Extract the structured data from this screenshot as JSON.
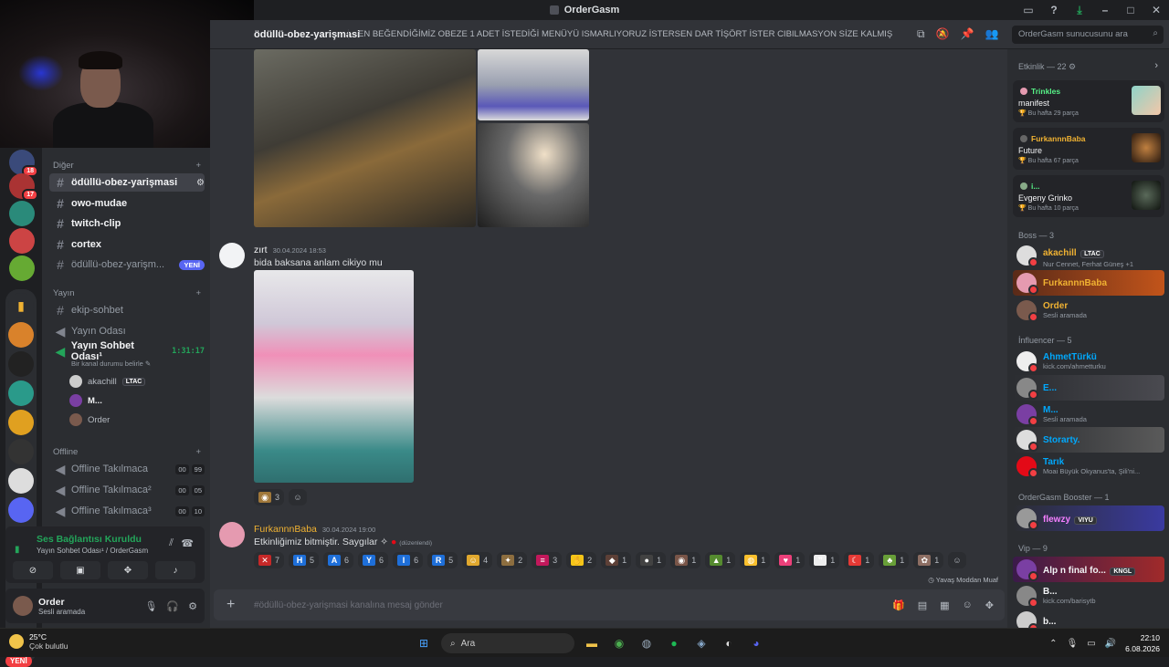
{
  "window": {
    "title": "OrderGasm"
  },
  "header": {
    "channel": "ödüllü-obez-yarişmasi",
    "topic": "EN BEĞENDİĞİMİZ OBEZE 1 ADET İSTEDİĞİ MENÜYÜ ISMARLIYORUZ İSTERSEN DAR TİŞÖRT İSTER CIBILMASYON SİZE KALMIŞ",
    "search_placeholder": "OrderGasm sunucusunu ara"
  },
  "servers": {
    "badges": [
      "18",
      "17"
    ],
    "new_label": "YENİ"
  },
  "channels": {
    "cat_other": "Diğer",
    "items_other": [
      {
        "name": "ödüllü-obez-yarişmasi"
      },
      {
        "name": "owo-mudae"
      },
      {
        "name": "twitch-clip"
      },
      {
        "name": "cortex"
      },
      {
        "name": "ödüllü-obez-yarişm...",
        "badge": "YENİ"
      }
    ],
    "cat_stream": "Yayın",
    "ekip": "ekip-sohbet",
    "yayin_odasi": "Yayın Odası",
    "yayin_sohbet": "Yayın Sohbet Odası¹",
    "timer": "1:31:17",
    "status_hint": "Bir kanal durumu belirle",
    "voice_users": [
      {
        "name": "akachill",
        "tag": "LTAC"
      },
      {
        "name": "M..."
      },
      {
        "name": "Order"
      }
    ],
    "cat_offline": "Offline",
    "offline": [
      {
        "name": "Offline Takılmaca",
        "c1": "00",
        "c2": "99"
      },
      {
        "name": "Offline Takılmaca²",
        "c1": "00",
        "c2": "05"
      },
      {
        "name": "Offline Takılmaca³",
        "c1": "00",
        "c2": "10"
      }
    ]
  },
  "voice": {
    "status": "Ses Bağlantısı Kuruldu",
    "sub": "Yayın Sohbet Odası¹ / OrderGasm"
  },
  "user": {
    "name": "Order",
    "status": "Sesli aramada"
  },
  "messages": [
    {
      "author": "zırt",
      "time": "30.04.2024 18:53",
      "text": "bida baksana anlam cikiyo mu",
      "reaction_count": "3"
    },
    {
      "author": "FurkannnBaba",
      "time": "30.04.2024 19:00",
      "text": "Etkinliğimiz bitmiştir. Saygılar",
      "edited": "(düzenlendi)"
    }
  ],
  "reactions": [
    {
      "glyph": "✕",
      "count": "7",
      "color": "#c62828"
    },
    {
      "glyph": "H",
      "count": "5",
      "color": "#1e6fd9"
    },
    {
      "glyph": "A",
      "count": "6",
      "color": "#1e6fd9"
    },
    {
      "glyph": "Y",
      "count": "6",
      "color": "#1e6fd9"
    },
    {
      "glyph": "I",
      "count": "6",
      "color": "#1e6fd9"
    },
    {
      "glyph": "R",
      "count": "5",
      "color": "#1e6fd9"
    },
    {
      "glyph": "☺",
      "count": "4",
      "color": "#e0a82e"
    },
    {
      "glyph": "✦",
      "count": "2",
      "color": "#8d6e3f"
    },
    {
      "glyph": "≡",
      "count": "3",
      "color": "#c2185b"
    },
    {
      "glyph": "✋",
      "count": "2",
      "color": "#f5c518"
    },
    {
      "glyph": "◆",
      "count": "1",
      "color": "#5d4037"
    },
    {
      "glyph": "●",
      "count": "1",
      "color": "#424242"
    },
    {
      "glyph": "◉",
      "count": "1",
      "color": "#795548"
    },
    {
      "glyph": "▲",
      "count": "1",
      "color": "#558b2f"
    },
    {
      "glyph": "◍",
      "count": "1",
      "color": "#fbc02d"
    },
    {
      "glyph": "♥",
      "count": "1",
      "color": "#ec407a"
    },
    {
      "glyph": "❞",
      "count": "1",
      "color": "#eeeeee"
    },
    {
      "glyph": "☾",
      "count": "1",
      "color": "#e53935"
    },
    {
      "glyph": "♣",
      "count": "1",
      "color": "#689f38"
    },
    {
      "glyph": "✿",
      "count": "1",
      "color": "#8d6e63"
    }
  ],
  "slowmode": "Yavaş Moddan Muaf",
  "composer_placeholder": "#ödüllü-obez-yarişmasi kanalına mesaj gönder",
  "members": {
    "activity_header": "Etkinlik — 22",
    "activities": [
      {
        "user": "Trinkles",
        "title": "manifest",
        "meta": "Bu hafta 29 parça",
        "color": "#57f287"
      },
      {
        "user": "FurkannnBaba",
        "title": "Future",
        "meta": "Bu hafta 67 parça",
        "color": "#f0b232"
      },
      {
        "user": "i...",
        "title": "Evgeny Grinko",
        "meta": "Bu hafta 10 parça",
        "color": "#57f287"
      }
    ],
    "boss_header": "Boss — 3",
    "boss": [
      {
        "name": "akachill",
        "tag": "LTAC",
        "sub": "Nur Cennet, Ferhat Güneş +1",
        "color": "#f0b232"
      },
      {
        "name": "FurkannnBaba",
        "sub": "",
        "color": "#f0b232"
      },
      {
        "name": "Order",
        "sub": "Sesli aramada",
        "color": "#f0b232"
      }
    ],
    "influencer_header": "İnfluencer — 5",
    "influencer": [
      {
        "name": "AhmetTürkü",
        "sub": "kick.com/ahmetturku",
        "color": "#00a8fc"
      },
      {
        "name": "E...",
        "sub": "",
        "color": "#00a8fc"
      },
      {
        "name": "M...",
        "sub": "Sesli aramada",
        "color": "#00a8fc"
      },
      {
        "name": "Storarty.",
        "sub": "",
        "color": "#00a8fc"
      },
      {
        "name": "Tarık",
        "sub": "Moai Büyük Okyanus'ta, Şili'ni...",
        "color": "#00a8fc"
      }
    ],
    "booster_header": "OrderGasm Booster — 1",
    "booster": [
      {
        "name": "flewzy",
        "tag": "VIYU",
        "color": "#f47fff"
      }
    ],
    "vip_header": "Vip — 9",
    "vip": [
      {
        "name": "Alp n final fo...",
        "tag": "KNGL",
        "sub": "",
        "color": "#f2f3f5"
      },
      {
        "name": "B...",
        "sub": "kick.com/barisytb",
        "color": "#f2f3f5"
      },
      {
        "name": "b...",
        "sub": "",
        "color": "#f2f3f5"
      }
    ]
  },
  "taskbar": {
    "temp": "25°C",
    "weather": "Çok bulutlu",
    "search": "Ara",
    "time": "22:10",
    "date": "6.08.2026"
  }
}
